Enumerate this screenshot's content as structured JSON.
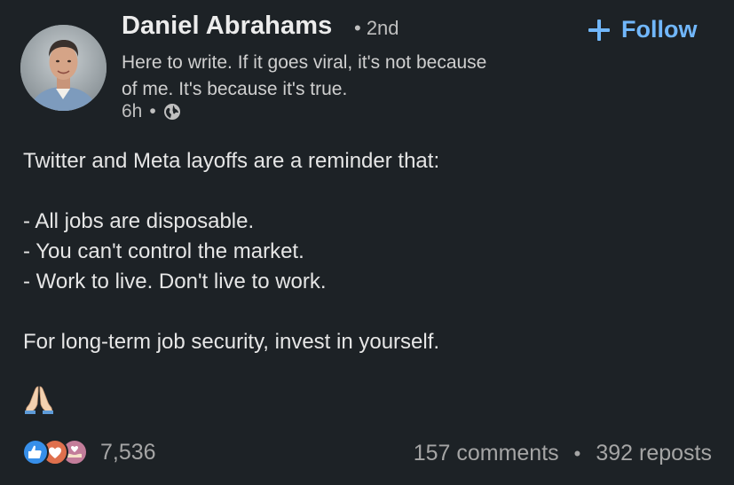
{
  "author": {
    "name": "Daniel Abrahams",
    "degree": "• 2nd",
    "headline": "Here to write. If it goes viral, it's not because of me. It's because it's true.",
    "time": "6h",
    "time_separator": "•",
    "visibility_icon": "globe-icon"
  },
  "follow_button": {
    "label": "Follow",
    "icon": "plus-icon",
    "color": "#71b7fb"
  },
  "post": {
    "lines": [
      "Twitter and Meta layoffs are a reminder that:",
      "- All jobs are disposable.",
      "- You can't control the market.",
      "- Work to live. Don't live to work.",
      "For long-term job security, invest in yourself."
    ],
    "emoji": "folded-hands"
  },
  "social": {
    "reaction_icons": [
      "like-icon",
      "love-icon",
      "support-icon"
    ],
    "reaction_count": "7,536",
    "comments": "157 comments",
    "separator": "•",
    "reposts": "392 reposts"
  },
  "colors": {
    "background": "#1d2226",
    "accent": "#71b7fb"
  }
}
